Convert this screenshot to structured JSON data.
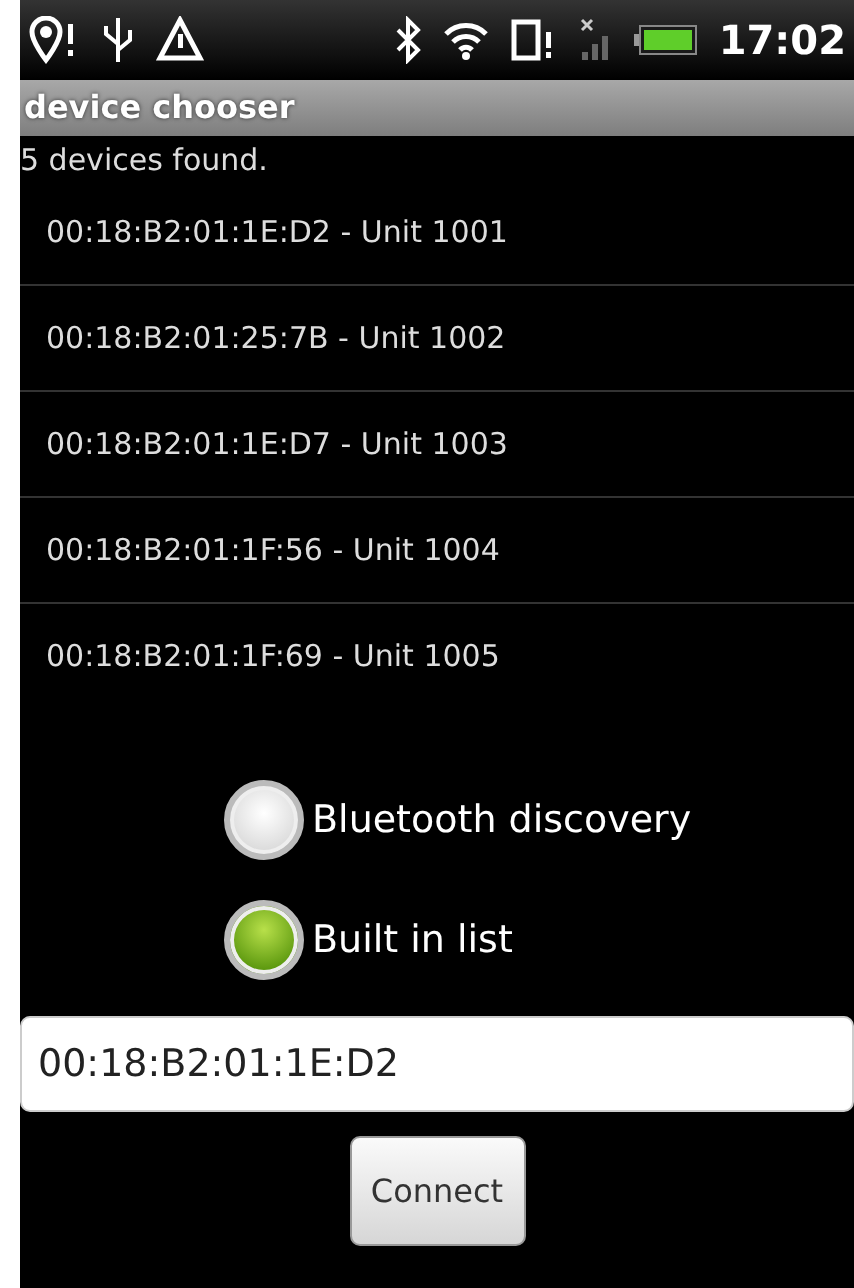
{
  "status_bar": {
    "time": "17:02"
  },
  "window": {
    "title": "device chooser"
  },
  "summary": "5 devices found.",
  "devices": [
    {
      "label": "00:18:B2:01:1E:D2 - Unit 1001"
    },
    {
      "label": "00:18:B2:01:25:7B - Unit 1002"
    },
    {
      "label": "00:18:B2:01:1E:D7 - Unit 1003"
    },
    {
      "label": "00:18:B2:01:1F:56 - Unit 1004"
    },
    {
      "label": "00:18:B2:01:1F:69 - Unit 1005"
    }
  ],
  "source_options": [
    {
      "label": "Bluetooth discovery",
      "selected": false
    },
    {
      "label": "Built in list",
      "selected": true
    }
  ],
  "address_field": {
    "value": "00:18:B2:01:1E:D2"
  },
  "buttons": [
    "Connect"
  ]
}
